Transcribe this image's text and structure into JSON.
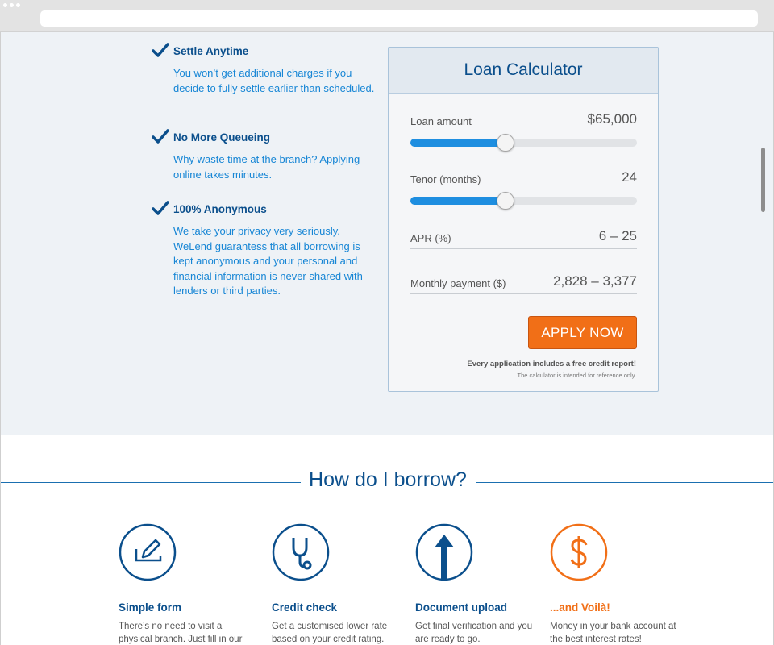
{
  "features": [
    {
      "title": "Settle Anytime",
      "desc": "You won’t get additional charges if you decide to fully settle earlier than scheduled."
    },
    {
      "title": "No More Queueing",
      "desc": "Why waste time at the branch? Applying online takes minutes."
    },
    {
      "title": "100% Anonymous",
      "desc": "We take your privacy very seriously. WeLend guarantess that all borrowing is kept anonymous and your personal and financial information is never shared with lenders or third parties."
    }
  ],
  "calculator": {
    "title": "Loan Calculator",
    "loan_amount_label": "Loan amount",
    "loan_amount_value": "$65,000",
    "loan_amount_slider_fraction": 0.42,
    "tenor_label": "Tenor (months)",
    "tenor_value": "24",
    "tenor_slider_fraction": 0.42,
    "apr_label": "APR (%)",
    "apr_value": "6 – 25",
    "monthly_label": "Monthly payment ($)",
    "monthly_value": "2,828 – 3,377",
    "apply_label": "APPLY NOW",
    "note_primary": "Every application includes a free credit report!",
    "note_secondary": "The calculator is intended for reference only."
  },
  "how": {
    "title": "How do I borrow?",
    "steps": [
      {
        "title": "Simple form",
        "desc": "There’s no need to visit a physical branch. Just fill in our"
      },
      {
        "title": "Credit check",
        "desc": "Get a customised lower rate based on your credit rating."
      },
      {
        "title": "Document upload",
        "desc": "Get final verification and you are ready to go."
      },
      {
        "title": "...and Voilà!",
        "desc": "Money in your bank account at the best interest rates!"
      }
    ]
  },
  "colors": {
    "brand_blue": "#0b4f8c",
    "link_blue": "#1786d5",
    "accent_orange": "#f16f17",
    "slider_blue": "#1e8ee0"
  }
}
